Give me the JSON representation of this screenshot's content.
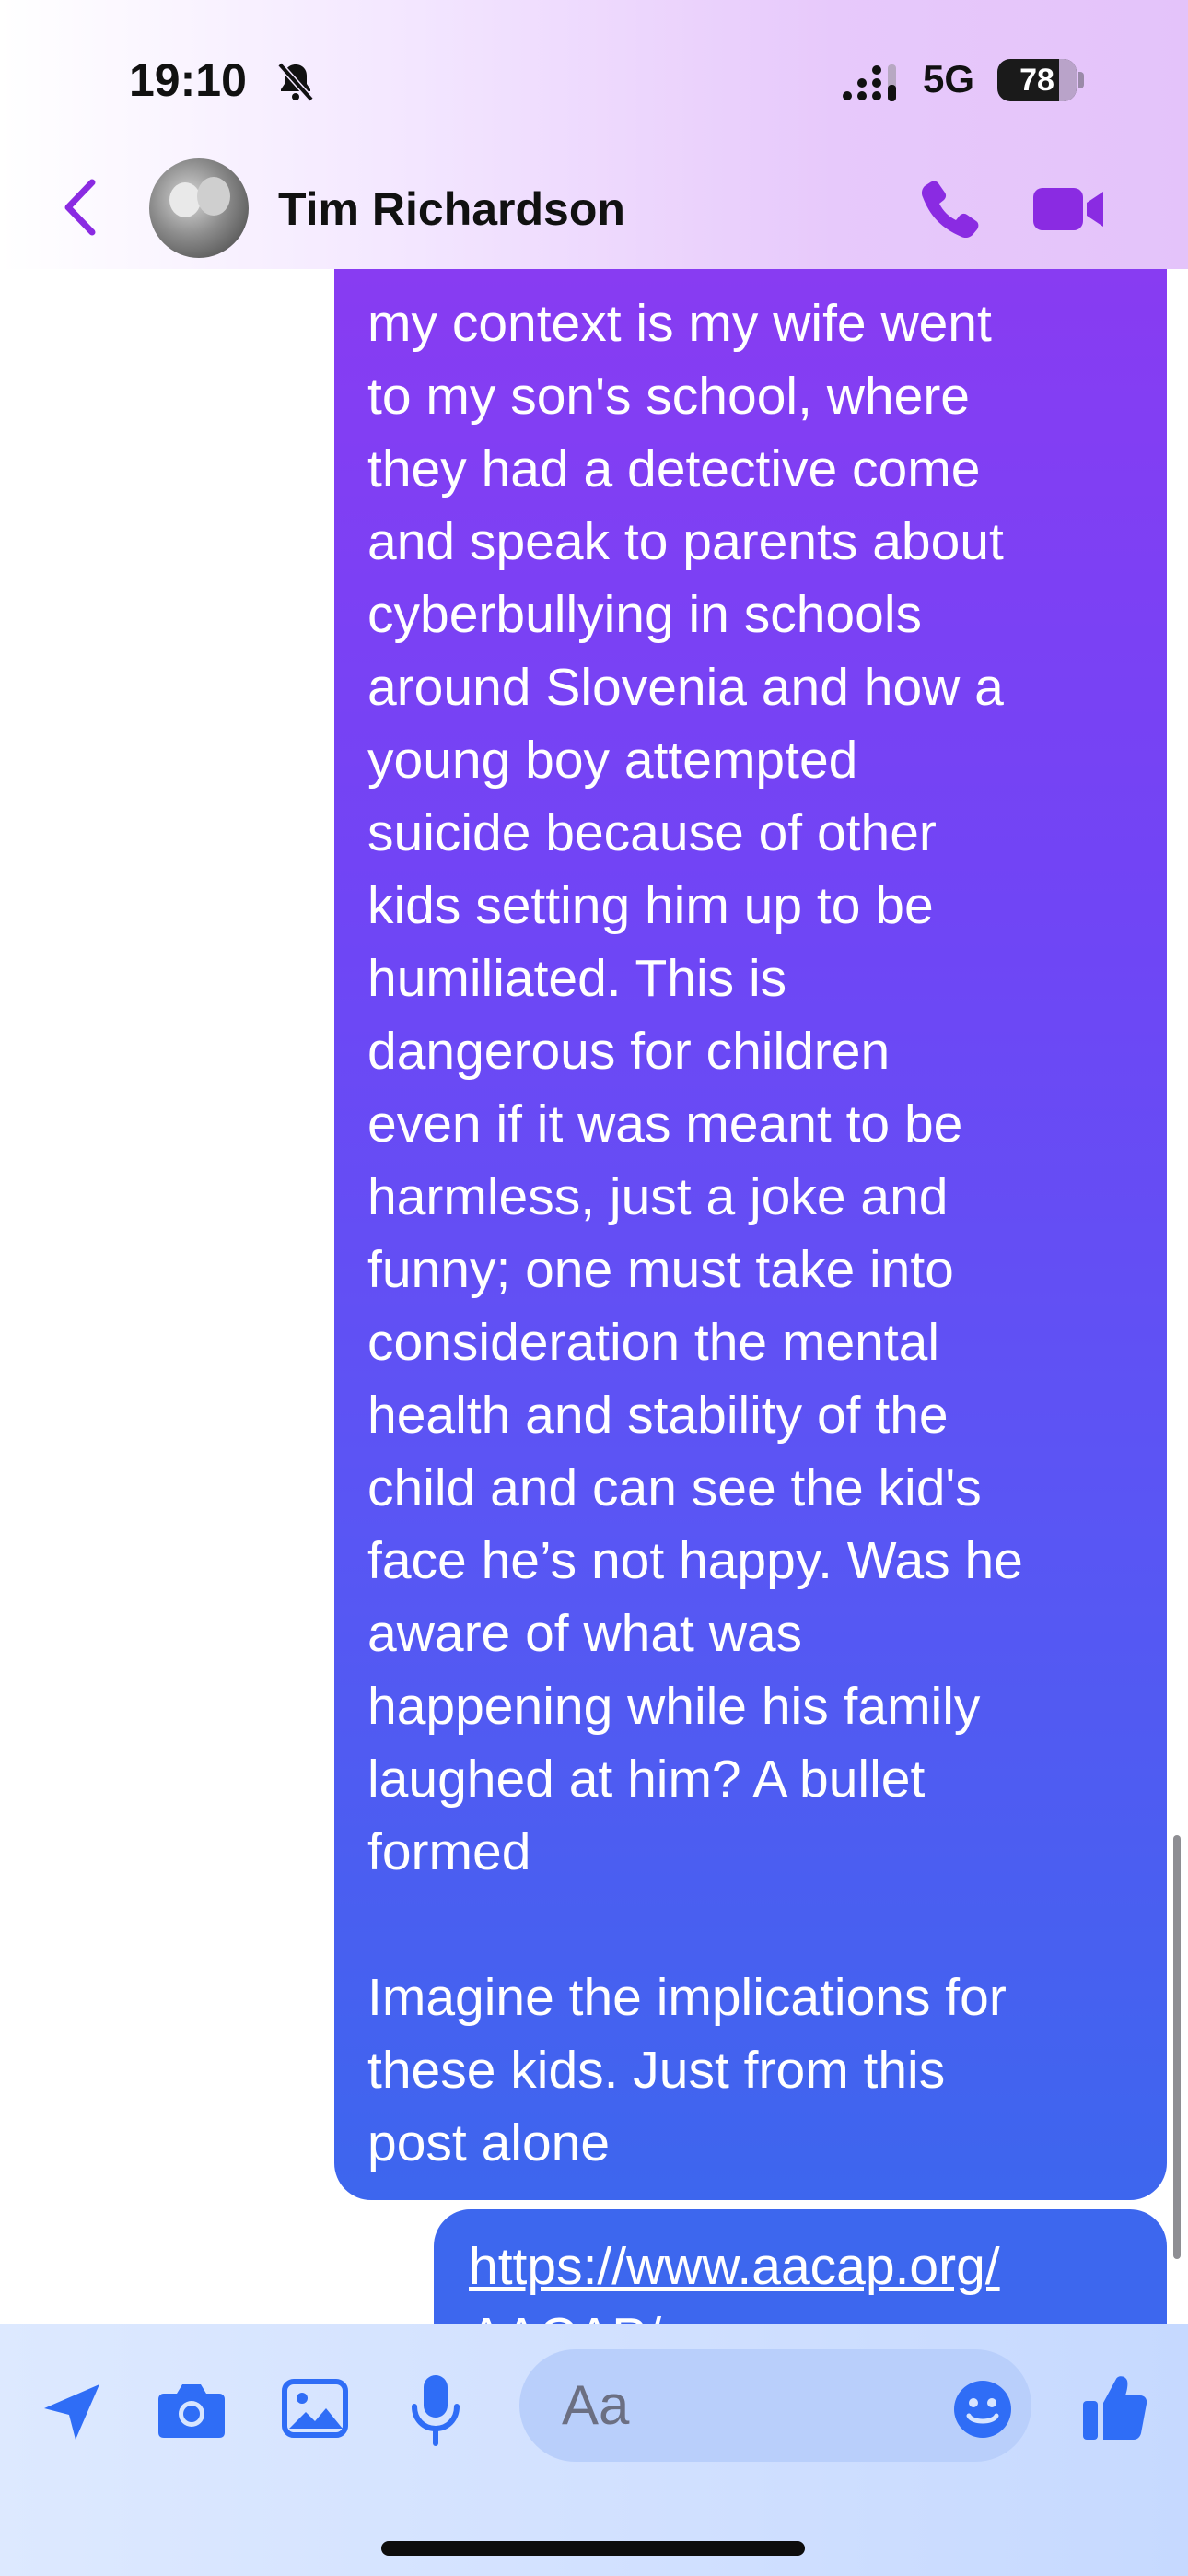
{
  "status_bar": {
    "time": "19:10",
    "network": "5G",
    "battery": "78"
  },
  "header": {
    "contact_name": "Tim Richardson",
    "accent_color": "#8a2be2",
    "icons": [
      "chevron-left-icon",
      "phone-icon",
      "video-camera-icon"
    ]
  },
  "messages": [
    {
      "sender": "me",
      "text": "my context is my wife went\nto my son's school, where\nthey had a detective come\nand speak to parents about\ncyberbullying in schools\naround Slovenia and how a\nyoung boy attempted\nsuicide because of other\nkids setting him up to be\nhumiliated. This is\ndangerous for children\neven if it was meant to be\nharmless, just a joke and\nfunny; one must take into\nconsideration the mental\nhealth and stability of the\nchild and can see the kid's\nface he’s not happy. Was he\naware of what was\nhappening while his family\nlaughed at him? A bullet\nformed\n\nImagine the implications for\nthese kids. Just from this\npost alone"
    },
    {
      "sender": "me",
      "text": "https://www.aacap.org/\nAACAP/"
    }
  ],
  "composer": {
    "placeholder": "Aa",
    "icons": [
      "send-location-icon",
      "camera-icon",
      "gallery-icon",
      "microphone-icon",
      "emoji-icon",
      "thumbs-up-icon"
    ],
    "accent_color": "#2f6df6"
  }
}
